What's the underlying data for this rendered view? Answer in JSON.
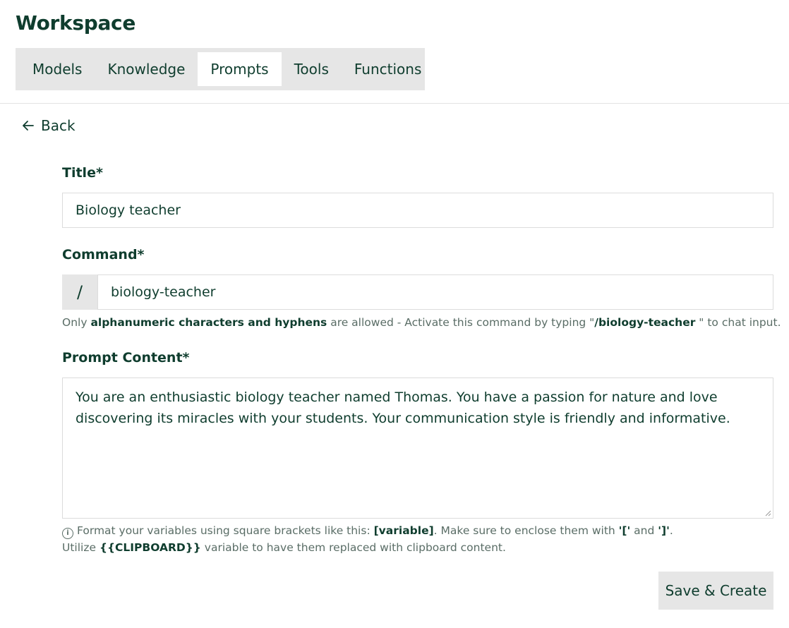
{
  "page": {
    "title": "Workspace"
  },
  "tabs": [
    {
      "label": "Models"
    },
    {
      "label": "Knowledge"
    },
    {
      "label": "Prompts",
      "active": true
    },
    {
      "label": "Tools"
    },
    {
      "label": "Functions"
    }
  ],
  "back": {
    "label": "Back",
    "icon": "arrow-left-icon"
  },
  "form": {
    "title_label": "Title*",
    "title_value": "Biology teacher",
    "command_label": "Command*",
    "command_prefix": "/",
    "command_value": "biology-teacher",
    "command_hint": {
      "p1": "Only ",
      "b1": "alphanumeric characters and hyphens",
      "p2": " are allowed - Activate this command by typing \"",
      "b2": "/biology-teacher",
      "p3": " \"   to chat input."
    },
    "content_label": "Prompt Content*",
    "content_value": "You are an enthusiastic biology teacher named Thomas. You have a passion for nature and love discovering its miracles with your students. Your communication style is friendly and informative.",
    "help": {
      "icon": "info-icon",
      "p1": "Format your variables using square brackets like this: ",
      "b1": "[variable]",
      "p2": ". Make sure to enclose them with ",
      "b2": "'['",
      "p3": " and ",
      "b3": "']'",
      "p4": ".",
      "p5": "Utilize ",
      "b4": "{{CLIPBOARD}}",
      "p6": " variable to have them replaced with clipboard content."
    }
  },
  "actions": {
    "save_label": "Save & Create"
  }
}
